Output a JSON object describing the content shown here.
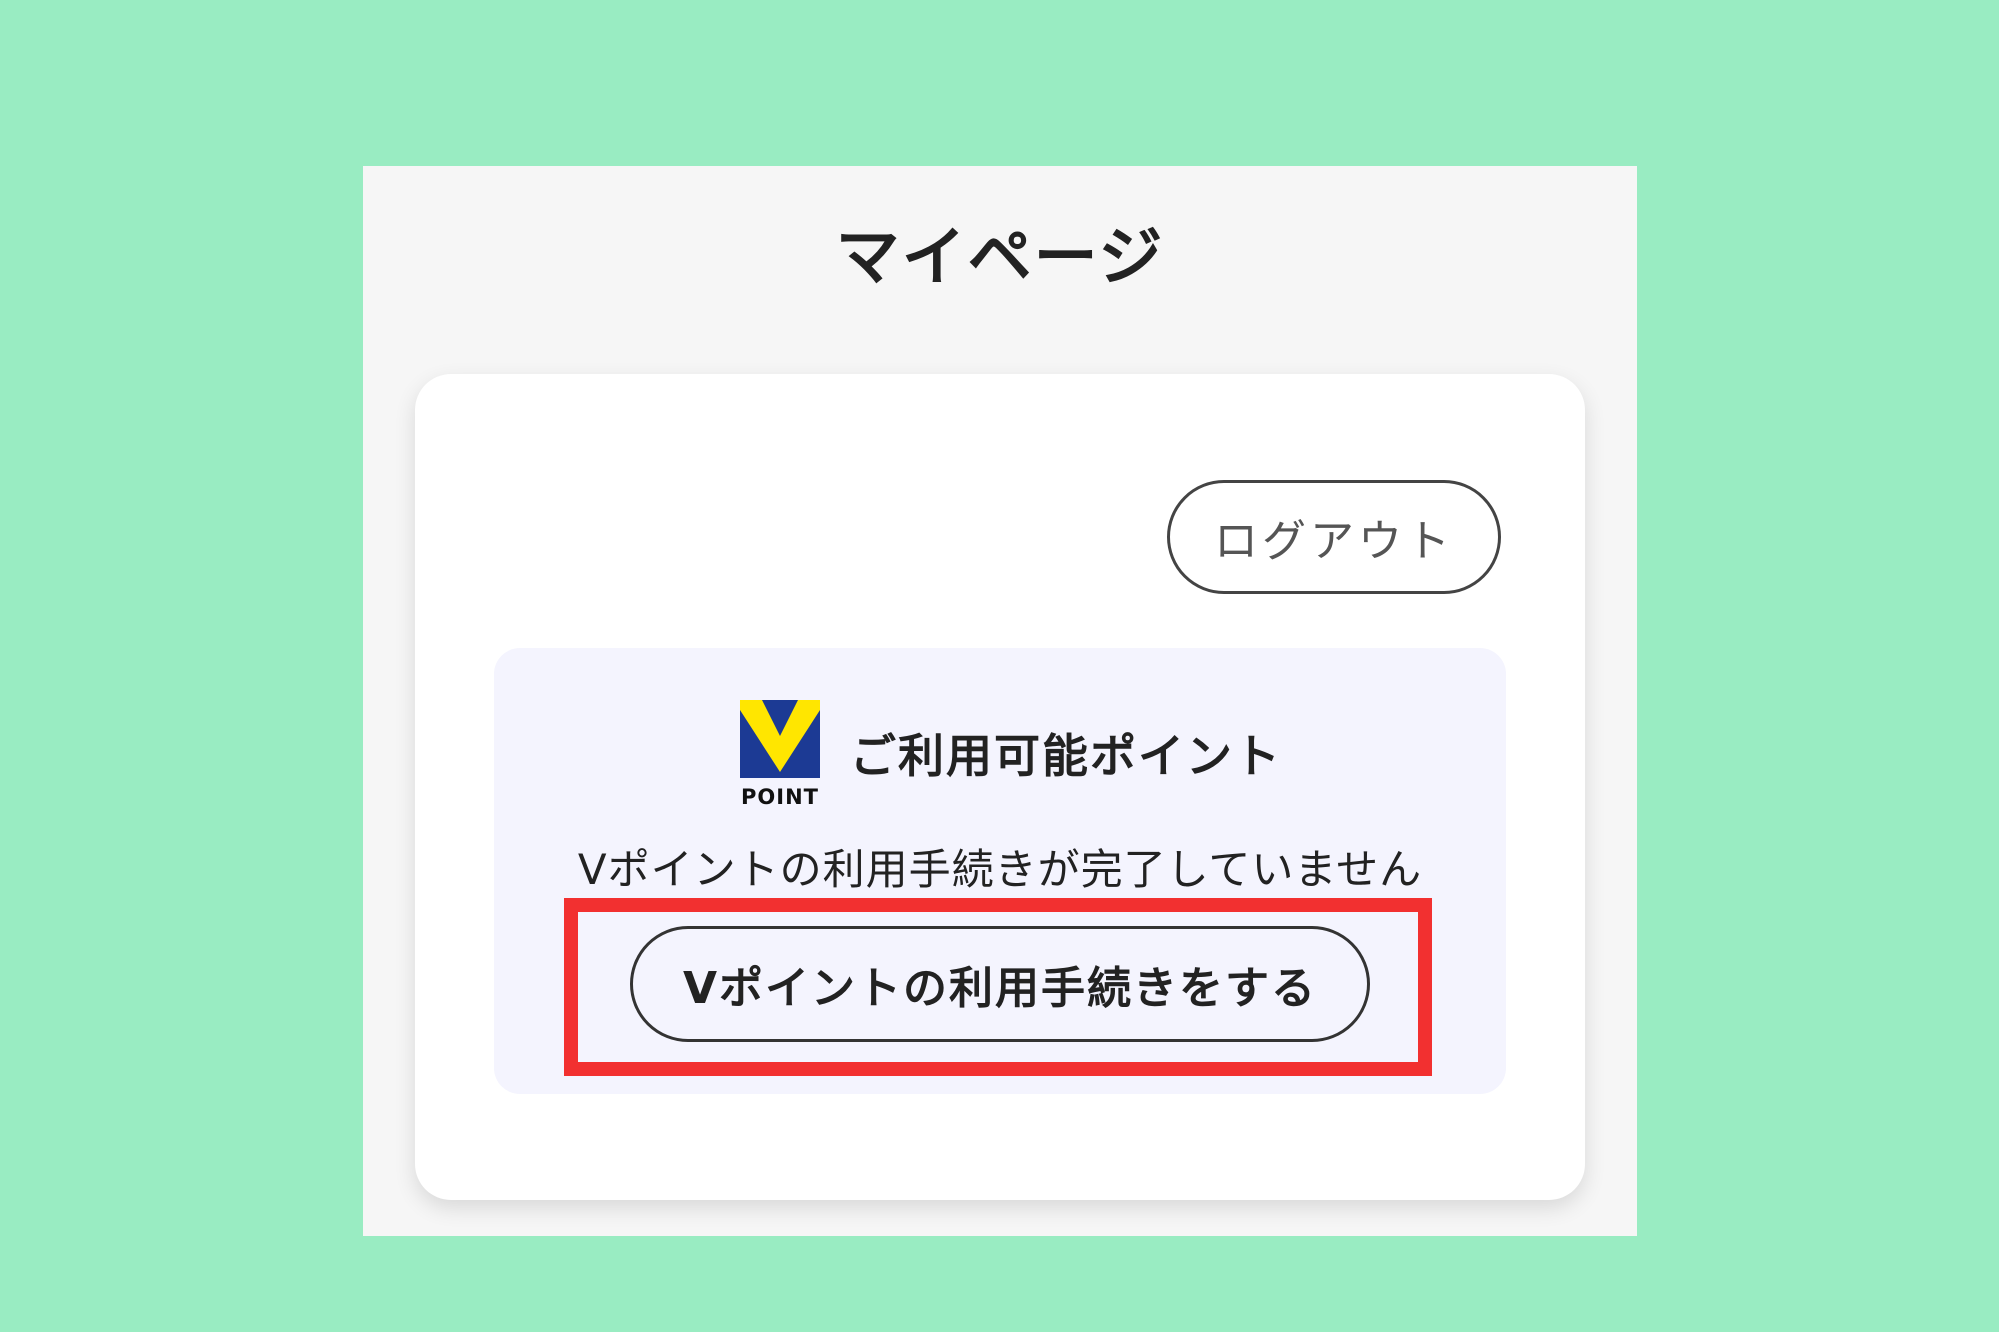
{
  "page": {
    "title": "マイページ"
  },
  "header": {
    "logout_label": "ログアウト"
  },
  "points": {
    "logo_text": "POINT",
    "title": "ご利用可能ポイント",
    "status_message": "Vポイントの利用手続きが完了していません",
    "register_button_label": "Vポイントの利用手続きをする"
  },
  "colors": {
    "background": "#99ecc2",
    "logo_blue": "#1c3a94",
    "logo_yellow": "#ffe600",
    "highlight_red": "#f23030"
  }
}
